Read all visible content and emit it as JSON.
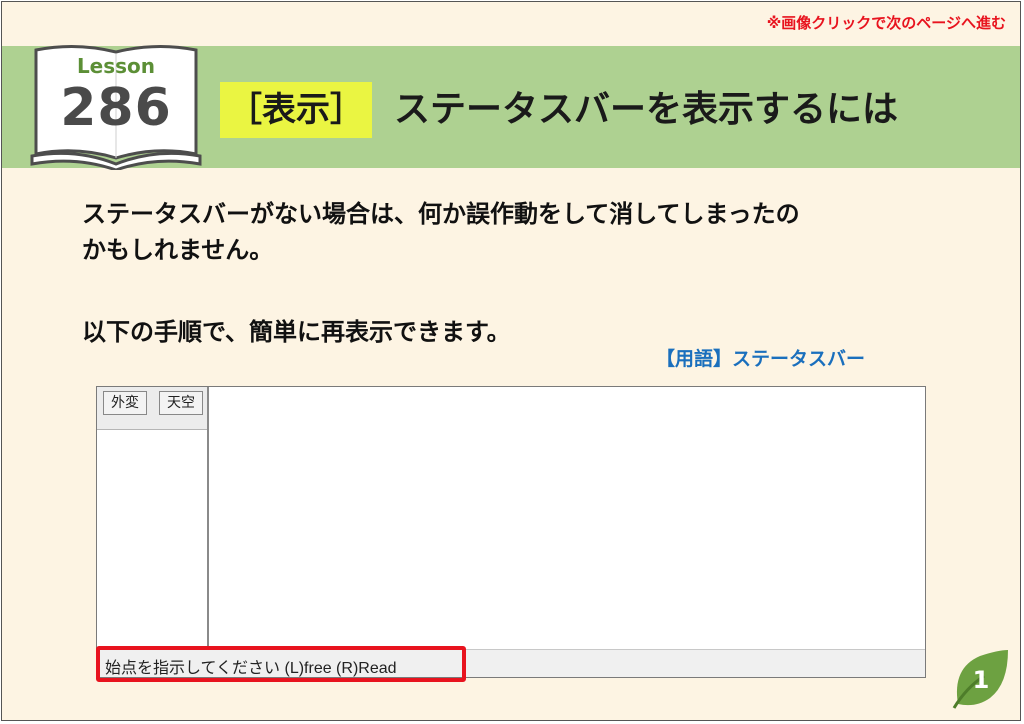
{
  "header": {
    "nav_hint": "※画像クリックで次のページへ進む",
    "lesson_label": "Lesson",
    "lesson_number": "286",
    "title_tag": "［表示］",
    "title": "ステータスバーを表示するには"
  },
  "body": {
    "line1": "ステータスバーがない場合は、何か誤作動をして消してしまったの",
    "line2": "かもしれません。",
    "line3": "以下の手順で、簡単に再表示できます。",
    "term_link": "【用語】ステータスバー"
  },
  "window": {
    "button_1": "外変",
    "button_2": "天空",
    "status_text": "始点を指示してください (L)free (R)Read"
  },
  "page_badge": "1",
  "colors": {
    "background": "#fdf4e3",
    "banner": "#aed191",
    "tag_highlight": "#eaf542",
    "red": "#e8131e",
    "link_blue": "#1a6fbd",
    "leaf_green": "#6da141"
  }
}
